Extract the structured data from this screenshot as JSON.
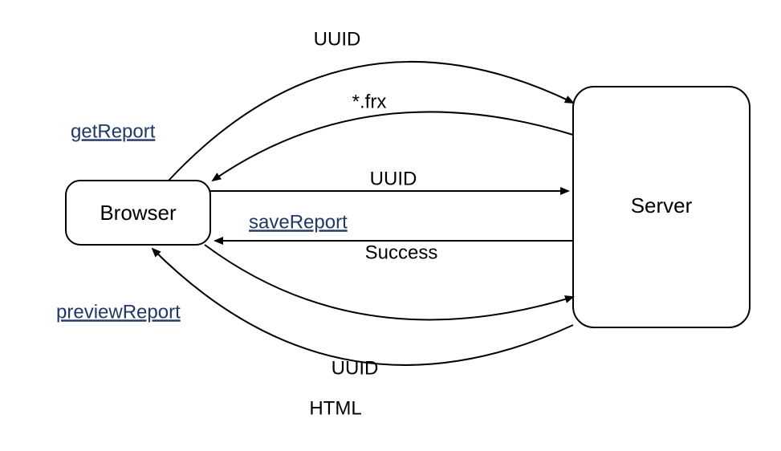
{
  "nodes": {
    "browser": "Browser",
    "server": "Server"
  },
  "groups": {
    "getReport": "getReport",
    "saveReport": "saveReport",
    "previewReport": "previewReport"
  },
  "edges": {
    "getReport_req": "UUID",
    "getReport_res": "*.frx",
    "saveReport_req": "UUID",
    "saveReport_res": "Success",
    "previewReport_req": "UUID",
    "previewReport_res": "HTML"
  }
}
